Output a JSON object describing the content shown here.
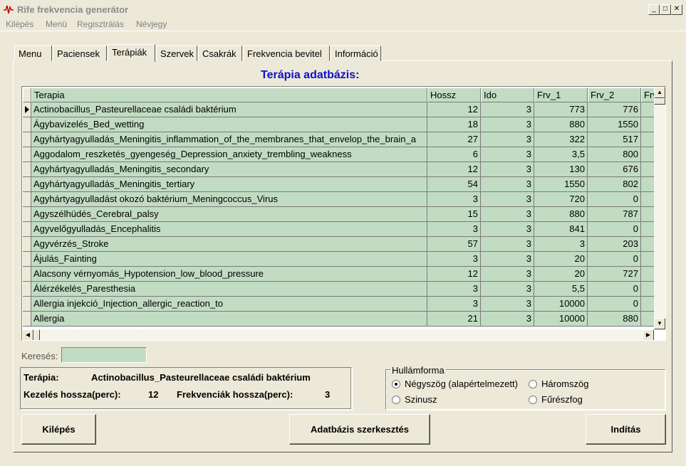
{
  "window": {
    "title": "Rife frekvencia generátor"
  },
  "menu": [
    "Kilépés",
    "Menü",
    "Regisztrálás",
    "Névjegy"
  ],
  "tabs": [
    "Menu",
    "Paciensek",
    "Terápiák",
    "Szervek",
    "Csakrák",
    "Frekvencia bevitel",
    "Információ"
  ],
  "active_tab": "Terápiák",
  "db_title": "Terápia adatbázis:",
  "grid": {
    "columns": [
      "Terapia",
      "Hossz",
      "Ido",
      "Frv_1",
      "Frv_2",
      "Frv"
    ],
    "rows": [
      [
        "Actinobacillus_Pasteurellaceae családi baktérium",
        "12",
        "3",
        "773",
        "776"
      ],
      [
        "Ágybavizelés_Bed_wetting",
        "18",
        "3",
        "880",
        "1550"
      ],
      [
        "Agyhártyagyulladás_Meningitis_inflammation_of_the_membranes_that_envelop_the_brain_a",
        "27",
        "3",
        "322",
        "517"
      ],
      [
        "Aggodalom_reszketés_gyengeség_Depression_anxiety_trembling_weakness",
        "6",
        "3",
        "3,5",
        "800"
      ],
      [
        "Agyhártyagyulladás_Meningitis_secondary",
        "12",
        "3",
        "130",
        "676"
      ],
      [
        "Agyhártyagyulladás_Meningitis_tertiary",
        "54",
        "3",
        "1550",
        "802"
      ],
      [
        "Agyhártyagyulladást okozó baktérium_Meningcoccus_Virus",
        "3",
        "3",
        "720",
        "0"
      ],
      [
        "Agyszélhüdés_Cerebral_palsy",
        "15",
        "3",
        "880",
        "787"
      ],
      [
        "Agyvelőgyulladás_Encephalitis",
        "3",
        "3",
        "841",
        "0"
      ],
      [
        "Agyvérzés_Stroke",
        "57",
        "3",
        "3",
        "203"
      ],
      [
        "Ájulás_Fainting",
        "3",
        "3",
        "20",
        "0"
      ],
      [
        "Alacsony vérnyomás_Hypotension_low_blood_pressure",
        "12",
        "3",
        "20",
        "727"
      ],
      [
        "Álérzékelés_Paresthesia",
        "3",
        "3",
        "5,5",
        "0"
      ],
      [
        "Allergia injekció_Injection_allergic_reaction_to",
        "3",
        "3",
        "10000",
        "0"
      ],
      [
        "Allergia",
        "21",
        "3",
        "10000",
        "880"
      ]
    ]
  },
  "search": {
    "label": "Keresés:",
    "value": ""
  },
  "info": {
    "therapy_label": "Terápia:",
    "therapy_value": "Actinobacillus_Pasteurellaceae családi baktérium",
    "duration_label": "Kezelés hossza(perc):",
    "duration_value": "12",
    "freq_label": "Frekvenciák hossza(perc):",
    "freq_value": "3"
  },
  "waveform": {
    "legend": "Hullámforma",
    "options": [
      "Négyszög (alapértelmezett)",
      "Háromszög",
      "Szinusz",
      "Fűrészfog"
    ],
    "selected": "Négyszög (alapértelmezett)"
  },
  "buttons": {
    "exit": "Kilépés",
    "edit_db": "Adatbázis szerkesztés",
    "start": "Indítás"
  }
}
